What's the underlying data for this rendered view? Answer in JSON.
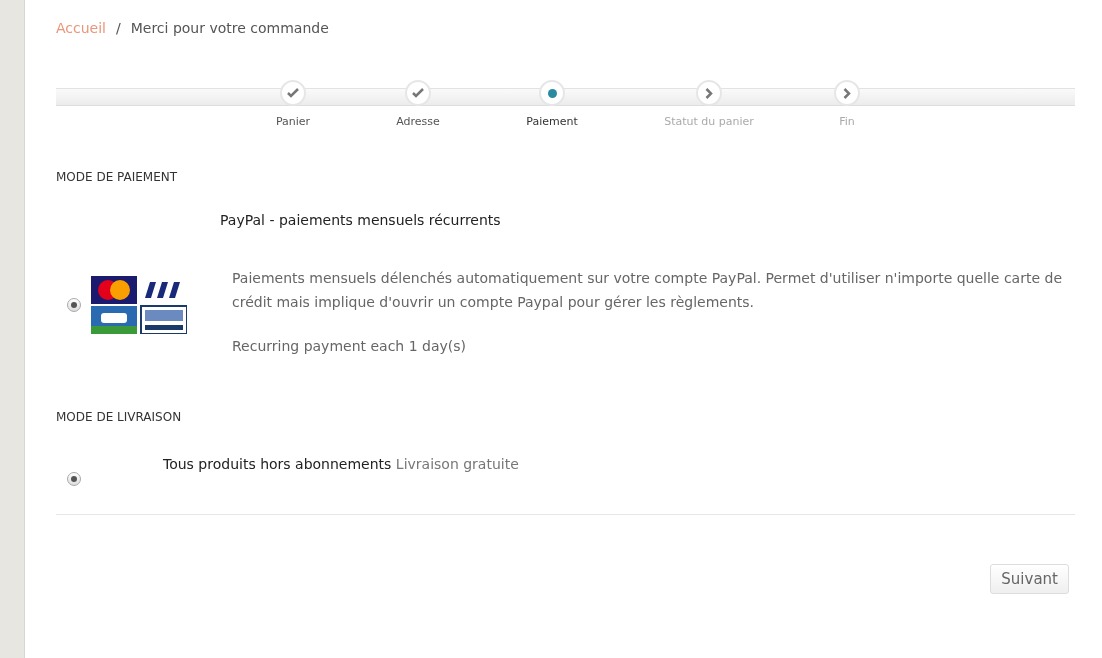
{
  "breadcrumb": {
    "home": "Accueil",
    "separator": "/",
    "current": "Merci pour votre commande"
  },
  "steps": [
    {
      "label": "Panier",
      "kind": "done"
    },
    {
      "label": "Adresse",
      "kind": "done"
    },
    {
      "label": "Paiement",
      "kind": "current"
    },
    {
      "label": "Statut du panier",
      "kind": "todo"
    },
    {
      "label": "Fin",
      "kind": "todo"
    }
  ],
  "payment": {
    "heading": "MODE DE PAIEMENT",
    "title": "PayPal - paiements mensuels récurrents",
    "selected": true,
    "description": "Paiements mensuels délenchés automatiquement sur votre compte PayPal. Permet d'utiliser n'importe quelle carte de crédit mais implique d'ouvrir un compte Paypal pour gérer les règlements.",
    "note": "Recurring payment each 1 day(s)"
  },
  "delivery": {
    "heading": "MODE DE LIVRAISON",
    "name": "Tous produits hors abonnements",
    "price": "Livraison gratuite",
    "selected": true
  },
  "next_button": "Suivant"
}
